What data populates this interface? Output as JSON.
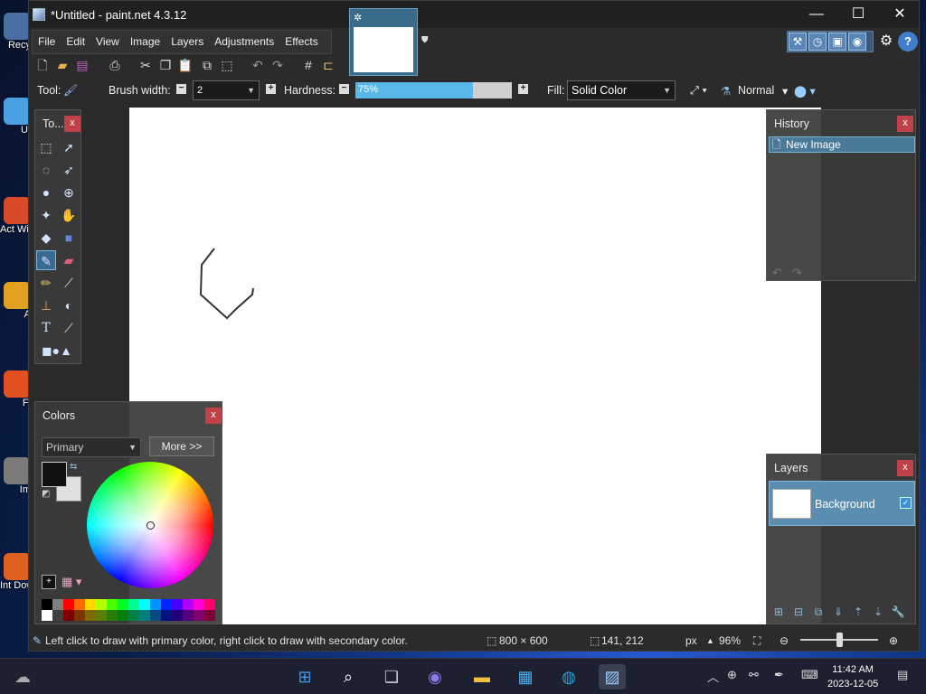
{
  "window": {
    "title": "*Untitled - paint.net 4.3.12",
    "minimize": "—",
    "maximize": "☐",
    "close": "✕"
  },
  "menu": [
    "File",
    "Edit",
    "View",
    "Image",
    "Layers",
    "Adjustments",
    "Effects"
  ],
  "desktop_icons": [
    {
      "label": "Recy",
      "color": "#4a6fa5"
    },
    {
      "label": "Ut",
      "color": "#4aa0e0"
    },
    {
      "label": "Act Win",
      "color": "#d84a2a"
    },
    {
      "label": "A",
      "color": "#e0a020"
    },
    {
      "label": "Fi",
      "color": "#e05020"
    },
    {
      "label": "Im",
      "color": "#7a7a7a"
    },
    {
      "label": "Int Dow",
      "color": "#e06020"
    }
  ],
  "options": {
    "tool_label": "Tool:",
    "brush_width_label": "Brush width:",
    "brush_width_value": "2",
    "hardness_label": "Hardness:",
    "hardness_value": "75%",
    "hardness_fraction": 0.75,
    "fill_label": "Fill:",
    "fill_value": "Solid Color",
    "blend_mode": "Normal"
  },
  "tools_panel": {
    "title": "To...",
    "close": "x"
  },
  "history_panel": {
    "title": "History",
    "close": "x",
    "items": [
      "New Image"
    ]
  },
  "colors_panel": {
    "title": "Colors",
    "close": "x",
    "select_value": "Primary",
    "more_button": "More >>",
    "primary_color": "#111111",
    "secondary_color": "#e0e0e0"
  },
  "layers_panel": {
    "title": "Layers",
    "close": "x",
    "layers": [
      {
        "name": "Background",
        "visible": true
      }
    ]
  },
  "status": {
    "hint": "Left click to draw with primary color, right click to draw with secondary color.",
    "image_size": "800 × 600",
    "cursor_pos": "141, 212",
    "units": "px",
    "zoom": "96%"
  },
  "taskbar": {
    "time": "11:42 AM",
    "date": "2023-12-05"
  },
  "palette": [
    "#000000",
    "#7f7f7f",
    "#ff0000",
    "#ff6a00",
    "#ffd800",
    "#b6ff00",
    "#4cff00",
    "#00ff21",
    "#00ff90",
    "#00ffff",
    "#0094ff",
    "#0026ff",
    "#4800ff",
    "#b200ff",
    "#ff00dc",
    "#ff006e",
    "#ffffff",
    "#404040",
    "#7f0000",
    "#7f3300",
    "#7f6a00",
    "#5b7f00",
    "#267f00",
    "#007f0e",
    "#007f46",
    "#007f7f",
    "#004a7f",
    "#00137f",
    "#21007f",
    "#57007f",
    "#7f006e",
    "#7f0037"
  ]
}
